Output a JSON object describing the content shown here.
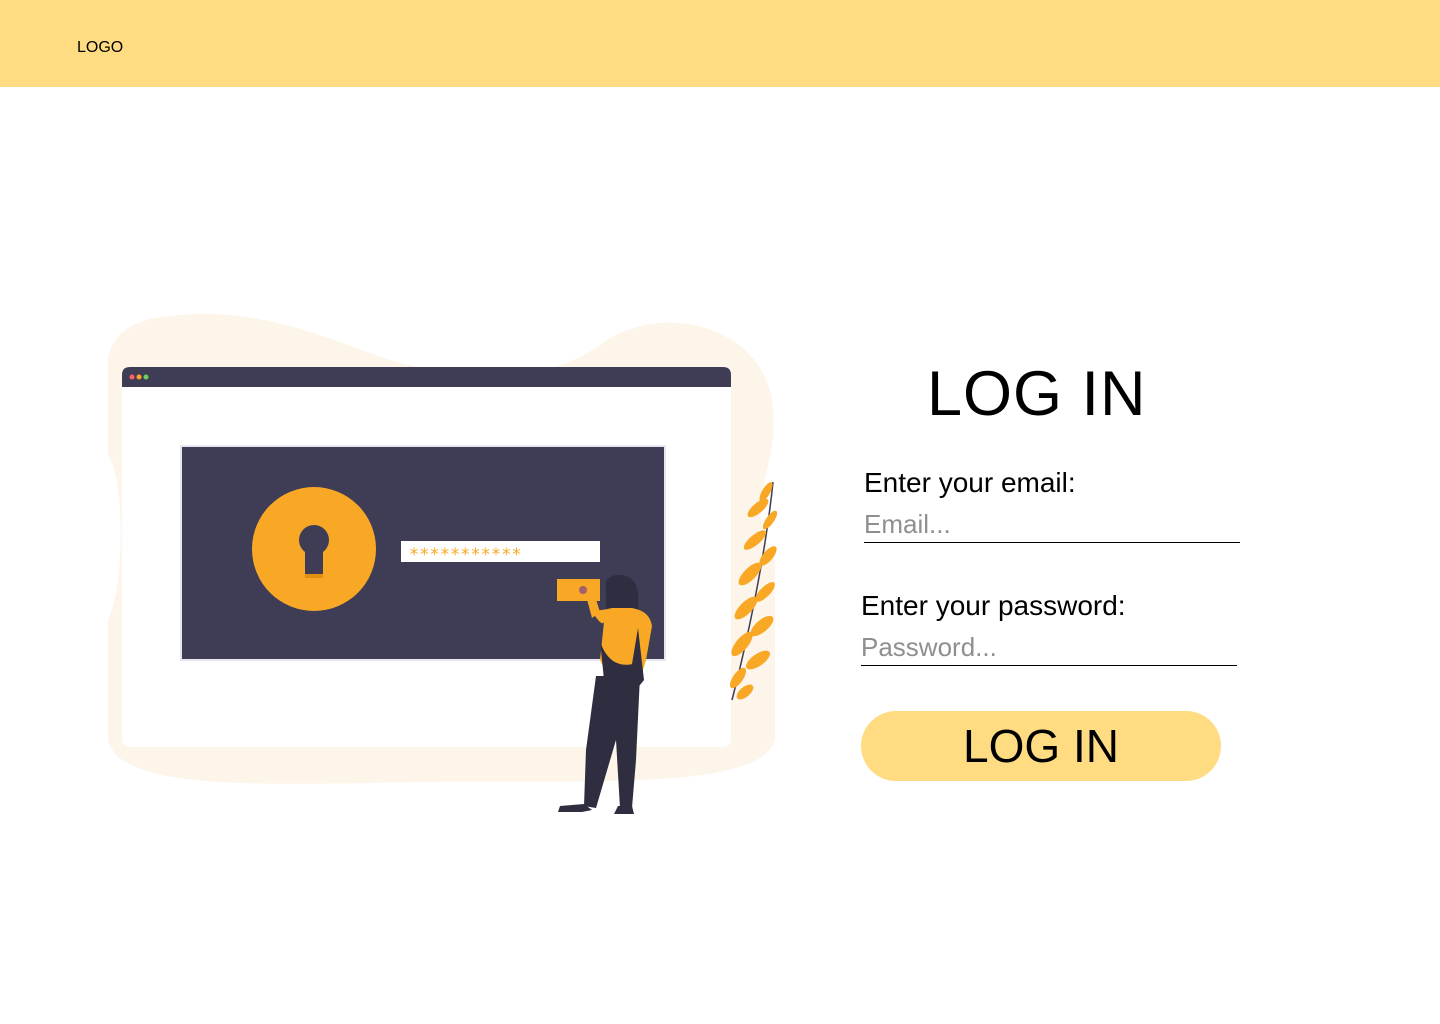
{
  "header": {
    "logo": "LOGO"
  },
  "illustration": {
    "password_mask": "***********"
  },
  "form": {
    "title": "LOG IN",
    "email_label": "Enter your email:",
    "email_placeholder": "Email...",
    "email_value": "",
    "password_label": "Enter your password:",
    "password_placeholder": "Password...",
    "password_value": "",
    "submit_label": "LOG IN"
  },
  "colors": {
    "brand_yellow": "#FFDC82",
    "accent_orange": "#F9A826",
    "dark_panel": "#3F3D56",
    "blob": "#FDF5EA"
  }
}
